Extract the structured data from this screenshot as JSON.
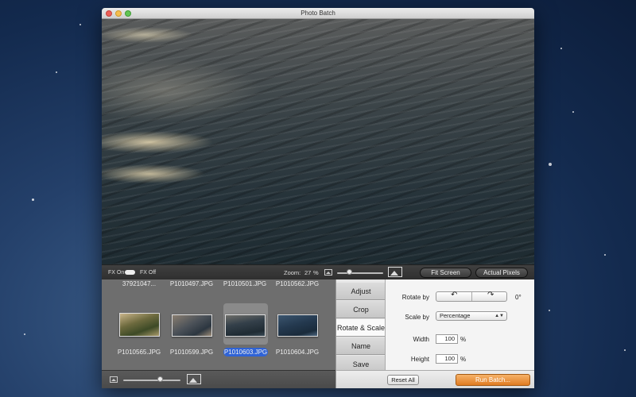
{
  "window": {
    "title": "Photo Batch"
  },
  "fx": {
    "on_label": "FX On",
    "off_label": "FX Off"
  },
  "zoom": {
    "label": "Zoom:",
    "value": "27",
    "unit": "%",
    "slider_fraction": 0.28
  },
  "view_buttons": {
    "fit_screen": "Fit Screen",
    "actual_pixels": "Actual Pixels"
  },
  "browser": {
    "top_row_names": [
      "37921047...",
      "P1010497.JPG",
      "P1010501.JPG",
      "P1010562.JPG"
    ],
    "thumbnails": [
      {
        "name": "P1010565.JPG",
        "selected": false
      },
      {
        "name": "P1010599.JPG",
        "selected": false
      },
      {
        "name": "P1010603.JPG",
        "selected": true
      },
      {
        "name": "P1010604.JPG",
        "selected": false
      }
    ],
    "thumb_size_fraction": 0.65
  },
  "tabs": [
    {
      "label": "Adjust",
      "active": false
    },
    {
      "label": "Crop",
      "active": false
    },
    {
      "label": "Rotate & Scale",
      "active": true
    },
    {
      "label": "Name",
      "active": false
    },
    {
      "label": "Save",
      "active": false
    }
  ],
  "rotate_scale": {
    "rotate_label": "Rotate by",
    "rotate_value": "0°",
    "scale_label": "Scale by",
    "scale_option": "Percentage",
    "width_label": "Width",
    "width_value": "100",
    "height_label": "Height",
    "height_value": "100",
    "unit": "%"
  },
  "footer": {
    "reset_all": "Reset All",
    "run_batch": "Run Batch..."
  },
  "colors": {
    "selection": "#2f63d6",
    "run_button": "#e07c22"
  }
}
